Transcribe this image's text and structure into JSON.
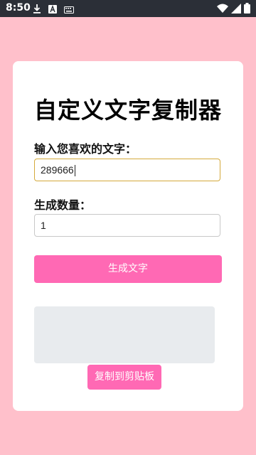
{
  "status_bar": {
    "time": "8:50",
    "left_icons": [
      "download-icon",
      "text-a-icon",
      "keyboard-icon"
    ],
    "right_icons": [
      "wifi-icon",
      "signal-icon",
      "battery-icon"
    ]
  },
  "page": {
    "title": "自定义文字复制器",
    "input_label": "输入您喜欢的文字：",
    "input_value": "289666",
    "count_label": "生成数量：",
    "count_value": "1",
    "generate_button": "生成文字",
    "output_text": "",
    "copy_button": "复制到剪贴板"
  },
  "colors": {
    "background": "#ffc0cb",
    "accent": "#ff69b4",
    "focus_border": "#d4a93b",
    "output_box": "#e8ebee"
  }
}
